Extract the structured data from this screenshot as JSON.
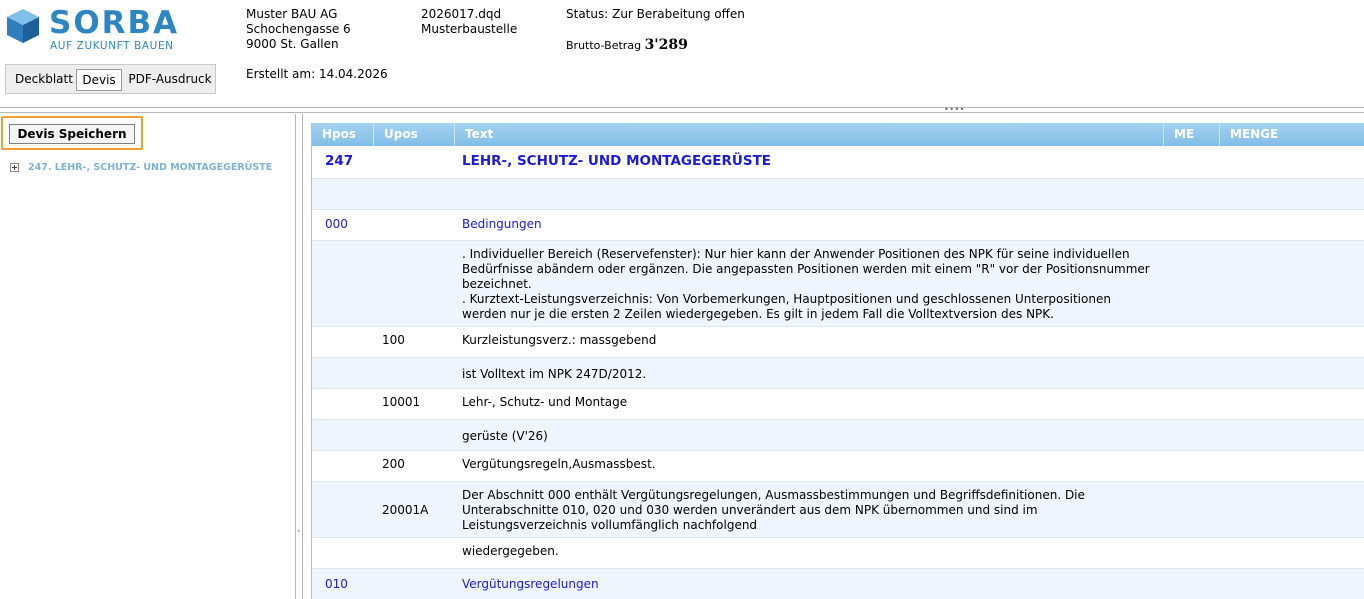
{
  "brand": {
    "name": "SORBA",
    "tagline": "AUF ZUKUNFT BAUEN",
    "color": "#2e86c1"
  },
  "tabs": [
    {
      "label": "Deckblatt",
      "active": false
    },
    {
      "label": "Devis",
      "active": true
    },
    {
      "label": "PDF-Ausdruck",
      "active": false
    }
  ],
  "company": {
    "name": "Muster BAU AG",
    "street": "Schochengasse 6",
    "city": "9000 St. Gallen",
    "created": "Erstellt am: 14.04.2026"
  },
  "project": {
    "file": "2026017.dqd",
    "site": "Musterbaustelle"
  },
  "status": {
    "text": "Status: Zur Berabeitung offen",
    "amount_label": "Brutto-Betrag",
    "amount_value": "3'289"
  },
  "sidebar": {
    "save_label": "Devis Speichern",
    "tree": [
      {
        "label": "247. LEHR-, SCHUTZ- UND MONTAGEGERÜSTE"
      }
    ]
  },
  "table": {
    "columns": [
      "Hpos",
      "Upos",
      "Text",
      "ME",
      "MENGE"
    ],
    "rows": [
      {
        "hpos": "247",
        "upos": "",
        "text": "LEHR-, SCHUTZ- UND MONTAGEGERÜSTE"
      },
      {
        "hpos": "",
        "upos": "",
        "text": ""
      },
      {
        "hpos": "000",
        "upos": "",
        "text": "Bedingungen"
      },
      {
        "hpos": "",
        "upos": "",
        "text": ". Individueller Bereich (Reservefenster): Nur hier kann der Anwender Positionen des NPK für seine individuellen\nBedürfnisse abändern oder ergänzen. Die angepassten Positionen werden mit einem \"R\" vor der Positionsnummer\nbezeichnet.\n. Kurztext-Leistungsverzeichnis: Von Vorbemerkungen, Hauptpositionen und geschlossenen Unterpositionen\nwerden nur je die ersten 2 Zeilen wiedergegeben. Es gilt in jedem Fall die Volltextversion des NPK."
      },
      {
        "hpos": "",
        "upos": "100",
        "text": "Kurzleistungsverz.: massgebend"
      },
      {
        "hpos": "",
        "upos": "",
        "text": "ist Volltext im NPK 247D/2012."
      },
      {
        "hpos": "",
        "upos": "10001",
        "text": "Lehr-, Schutz- und Montage"
      },
      {
        "hpos": "",
        "upos": "",
        "text": "gerüste (V'26)"
      },
      {
        "hpos": "",
        "upos": "200",
        "text": "Vergütungsregeln,Ausmassbest."
      },
      {
        "hpos": "",
        "upos": "20001A",
        "text": "Der Abschnitt 000 enthält Vergütungsregelungen, Ausmassbestimmungen und Begriffsdefinitionen. Die\nUnterabschnitte 010, 020 und 030 werden unverändert aus dem NPK übernommen und sind im\nLeistungsverzeichnis vollumfänglich nachfolgend"
      },
      {
        "hpos": "",
        "upos": "",
        "text": "wiedergegeben."
      },
      {
        "hpos": "010",
        "upos": "",
        "text": "Vergütungsregelungen"
      }
    ]
  }
}
